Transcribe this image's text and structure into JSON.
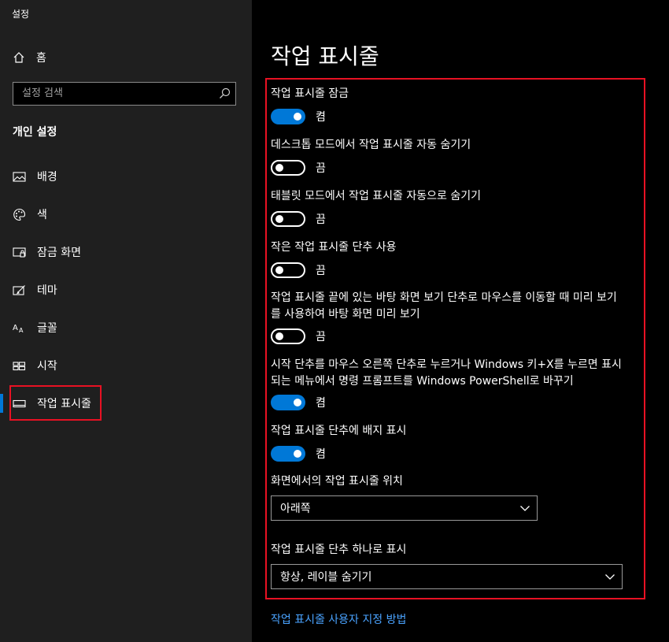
{
  "app_title": "설정",
  "sidebar": {
    "home_label": "홈",
    "search": {
      "placeholder": "설정 검색",
      "value": ""
    },
    "section_title": "개인 설정",
    "items": [
      {
        "label": "배경",
        "icon": "picture-icon"
      },
      {
        "label": "색",
        "icon": "palette-icon"
      },
      {
        "label": "잠금 화면",
        "icon": "lock-screen-icon"
      },
      {
        "label": "테마",
        "icon": "theme-icon"
      },
      {
        "label": "글꼴",
        "icon": "font-icon"
      },
      {
        "label": "시작",
        "icon": "start-icon"
      },
      {
        "label": "작업 표시줄",
        "icon": "taskbar-icon",
        "active": true
      }
    ]
  },
  "main": {
    "title": "작업 표시줄",
    "settings": [
      {
        "label": "작업 표시줄 잠금",
        "state": "켬",
        "on": true
      },
      {
        "label": "데스크톱 모드에서 작업 표시줄 자동 숨기기",
        "state": "끔",
        "on": false
      },
      {
        "label": "태블릿 모드에서 작업 표시줄 자동으로 숨기기",
        "state": "끔",
        "on": false
      },
      {
        "label": "작은 작업 표시줄 단추 사용",
        "state": "끔",
        "on": false
      },
      {
        "label": "작업 표시줄 끝에 있는 바탕 화면 보기 단추로 마우스를 이동할 때 미리 보기를 사용하여 바탕 화면 미리 보기",
        "state": "끔",
        "on": false
      },
      {
        "label": "시작 단추를 마우스 오른쪽 단추로 누르거나 Windows 키+X를 누르면 표시되는 메뉴에서 명령 프롬프트를 Windows PowerShell로 바꾸기",
        "state": "켬",
        "on": true
      },
      {
        "label": "작업 표시줄 단추에 배지 표시",
        "state": "켬",
        "on": true
      }
    ],
    "position": {
      "label": "화면에서의 작업 표시줄 위치",
      "value": "아래쪽"
    },
    "combine": {
      "label": "작업 표시줄 단추 하나로 표시",
      "value": "항상, 레이블 숨기기"
    },
    "link": "작업 표시줄 사용자 지정 방법"
  },
  "colors": {
    "accent": "#0078d7",
    "highlight": "#e81123",
    "link": "#4aa3ff"
  }
}
